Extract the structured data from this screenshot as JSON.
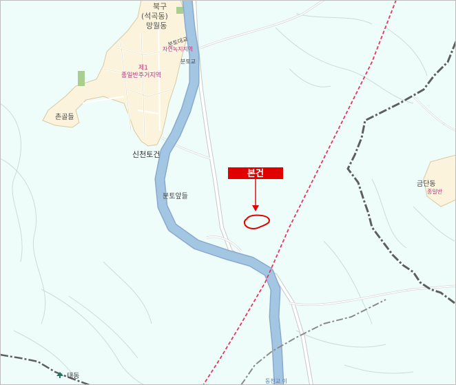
{
  "map": {
    "colors": {
      "background": "#eefcfa",
      "urban": "#fbf3dc",
      "river": "#9fc3e0",
      "river_edge": "#8aa9cf",
      "road": "#ffffff",
      "contour": "#c9ddd8",
      "boundary_red": "#e8345f",
      "boundary_gray": "#5e5e5e",
      "marker": "#e00000"
    },
    "labels": {
      "bukgu": "북구",
      "seokgokdong": "(석곡동)",
      "mangwoldong": "망월동",
      "bunto_daegyo": "분토대교",
      "jiku_top": "자연녹지지역",
      "buntogyo": "분토교",
      "je1": "제1",
      "jeil_jugeo": "종일반주거지역",
      "chongoldeul": "촌골들",
      "sincheon_togeon": "신천토건",
      "buntoapdeul": "분토앞들",
      "geumdandong": "금단동",
      "jongil_right": "종일반",
      "taedong": "태동",
      "bottom_label": "동천교 이"
    },
    "marker": {
      "label": "본건"
    }
  }
}
